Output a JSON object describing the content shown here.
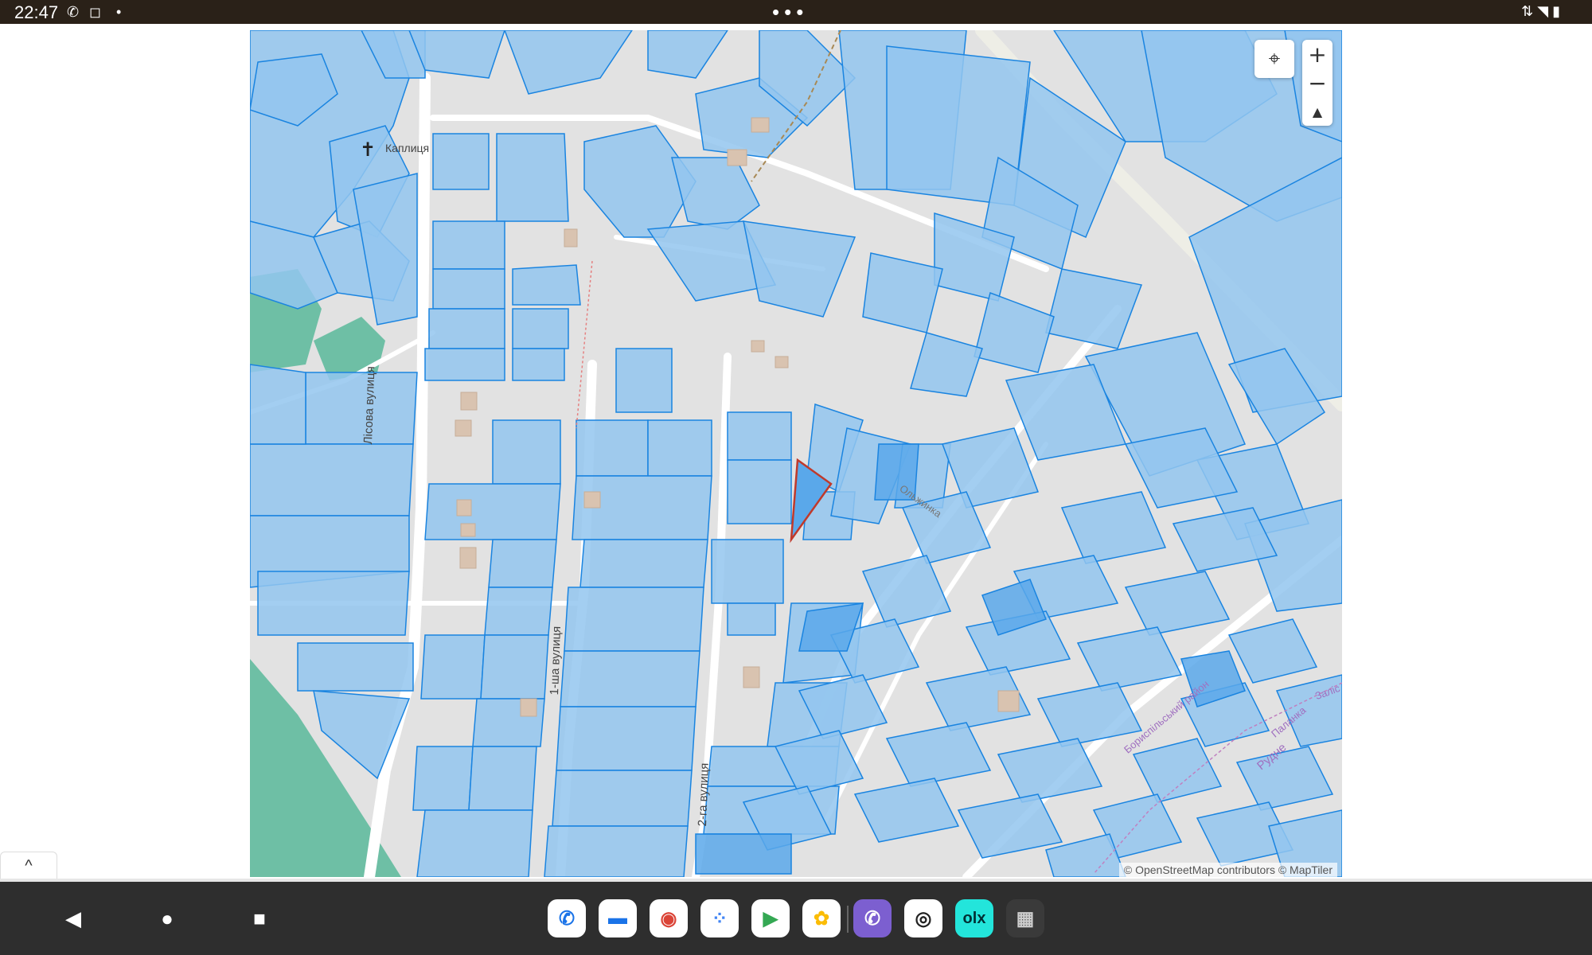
{
  "status_bar": {
    "time": "22:47",
    "left_icons": [
      "viber-icon",
      "instagram-icon",
      "dot-icon"
    ],
    "center_indicator": "•••",
    "right_icons": [
      "data-arrows-icon",
      "wifi-icon",
      "battery-icon"
    ]
  },
  "map": {
    "labels": {
      "chapel": "Каплиця",
      "street_lisova": "Лісова вулиця",
      "street_1sha": "1-ша вулиця",
      "street_2ga": "2-га вулиця",
      "street_diag": "Ольжинка",
      "district": "Бориспільський район",
      "village": "Рудне",
      "corner_street": "Заліс",
      "border": "Паланка"
    },
    "attribution": "© OpenStreetMap contributors © MapTiler",
    "colors": {
      "parcel_fill": "#93c5ef",
      "parcel_stroke": "#1a84e0",
      "selected_stroke": "#c0392b",
      "road": "#ffffff",
      "forest": "#6ebfa5",
      "background": "#e2e2e2"
    },
    "controls": {
      "zoom_in": "+",
      "zoom_out": "−",
      "compass": "▲",
      "map_pin_icon": "map-pin-icon"
    }
  },
  "bottom": {
    "collapse": "^"
  },
  "dock": {
    "nav": [
      "back-icon",
      "home-icon",
      "recents-icon"
    ],
    "apps": [
      {
        "name": "phone-icon",
        "color": "#ffffff",
        "glyph": "📞"
      },
      {
        "name": "messages-icon",
        "color": "#ffffff",
        "glyph": "💬"
      },
      {
        "name": "chrome-icon",
        "color": "#ffffff",
        "glyph": "◉"
      },
      {
        "name": "assistant-icon",
        "color": "#ffffff",
        "glyph": "⁘"
      },
      {
        "name": "play-store-icon",
        "color": "#ffffff",
        "glyph": "▶"
      },
      {
        "name": "photos-icon",
        "color": "#ffffff",
        "glyph": "✿"
      },
      {
        "name": "viber-icon",
        "color": "#7c5fd0",
        "glyph": "✆"
      },
      {
        "name": "camera-icon",
        "color": "#ffffff",
        "glyph": "◎"
      },
      {
        "name": "olx-icon",
        "color": "#23e5db",
        "glyph": "olx"
      },
      {
        "name": "app-drawer-icon",
        "color": "#3a3a3a",
        "glyph": "▦"
      }
    ]
  }
}
